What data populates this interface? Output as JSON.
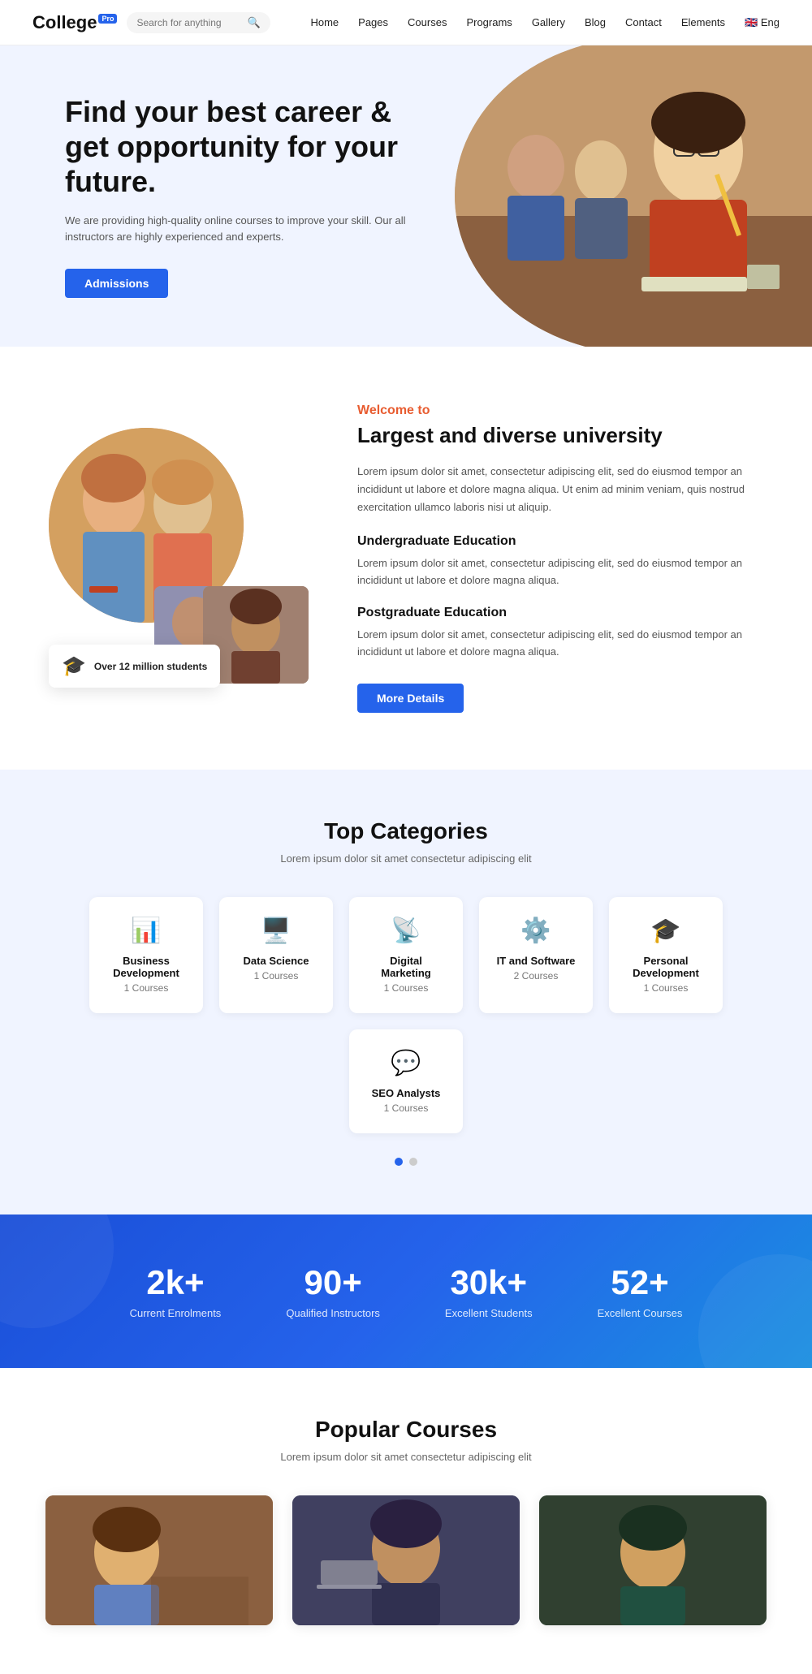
{
  "nav": {
    "logo": "College",
    "logo_badge": "Pro",
    "search_placeholder": "Search for anything",
    "links": [
      "Home",
      "Pages",
      "Courses",
      "Programs",
      "Gallery",
      "Blog",
      "Contact",
      "Elements"
    ],
    "lang": "Eng"
  },
  "hero": {
    "title": "Find your best career & get opportunity for your future.",
    "subtitle": "We are providing high-quality online courses to improve your skill. Our all instructors are highly experienced and experts.",
    "cta_label": "Admissions"
  },
  "about": {
    "welcome_label": "Welcome to",
    "title": "Largest and diverse university",
    "description": "Lorem ipsum dolor sit amet, consectetur adipiscing elit, sed do eiusmod tempor an incididunt ut labore et dolore magna aliqua. Ut enim ad minim veniam, quis nostrud exercitation ullamco laboris nisi ut aliquip.",
    "undergrad_heading": "Undergraduate Education",
    "undergrad_text": "Lorem ipsum dolor sit amet, consectetur adipiscing elit, sed do eiusmod tempor an incididunt ut labore et dolore magna aliqua.",
    "postgrad_heading": "Postgraduate Education",
    "postgrad_text": "Lorem ipsum dolor sit amet, consectetur adipiscing elit, sed do eiusmod tempor an incididunt ut labore et dolore magna aliqua.",
    "cta_label": "More Details",
    "stat_label": "Over 12 million students"
  },
  "categories": {
    "title": "Top Categories",
    "subtitle": "Lorem ipsum dolor sit amet consectetur adipiscing elit",
    "items": [
      {
        "id": "business",
        "name": "Business Development",
        "count": "1 Courses",
        "icon": "📊",
        "color": "#e85c30"
      },
      {
        "id": "data",
        "name": "Data Science",
        "count": "1 Courses",
        "icon": "🖥️",
        "color": "#2bb5c8"
      },
      {
        "id": "digital",
        "name": "Digital Marketing",
        "count": "1 Courses",
        "icon": "📡",
        "color": "#4a90d9"
      },
      {
        "id": "it",
        "name": "IT and Software",
        "count": "2 Courses",
        "icon": "⚙️",
        "color": "#e8a020"
      },
      {
        "id": "personal",
        "name": "Personal Development",
        "count": "1 Courses",
        "icon": "🎓",
        "color": "#2eaa7a"
      },
      {
        "id": "seo",
        "name": "SEO Analysts",
        "count": "1 Courses",
        "icon": "💬",
        "color": "#9090a0"
      }
    ],
    "dots": [
      true,
      false
    ]
  },
  "stats": {
    "items": [
      {
        "value": "2k+",
        "label": "Current Enrolments"
      },
      {
        "value": "90+",
        "label": "Qualified Instructors"
      },
      {
        "value": "30k+",
        "label": "Excellent Students"
      },
      {
        "value": "52+",
        "label": "Excellent Courses"
      }
    ]
  },
  "popular": {
    "title": "Popular Courses",
    "subtitle": "Lorem ipsum dolor sit amet consectetur adipiscing elit"
  }
}
